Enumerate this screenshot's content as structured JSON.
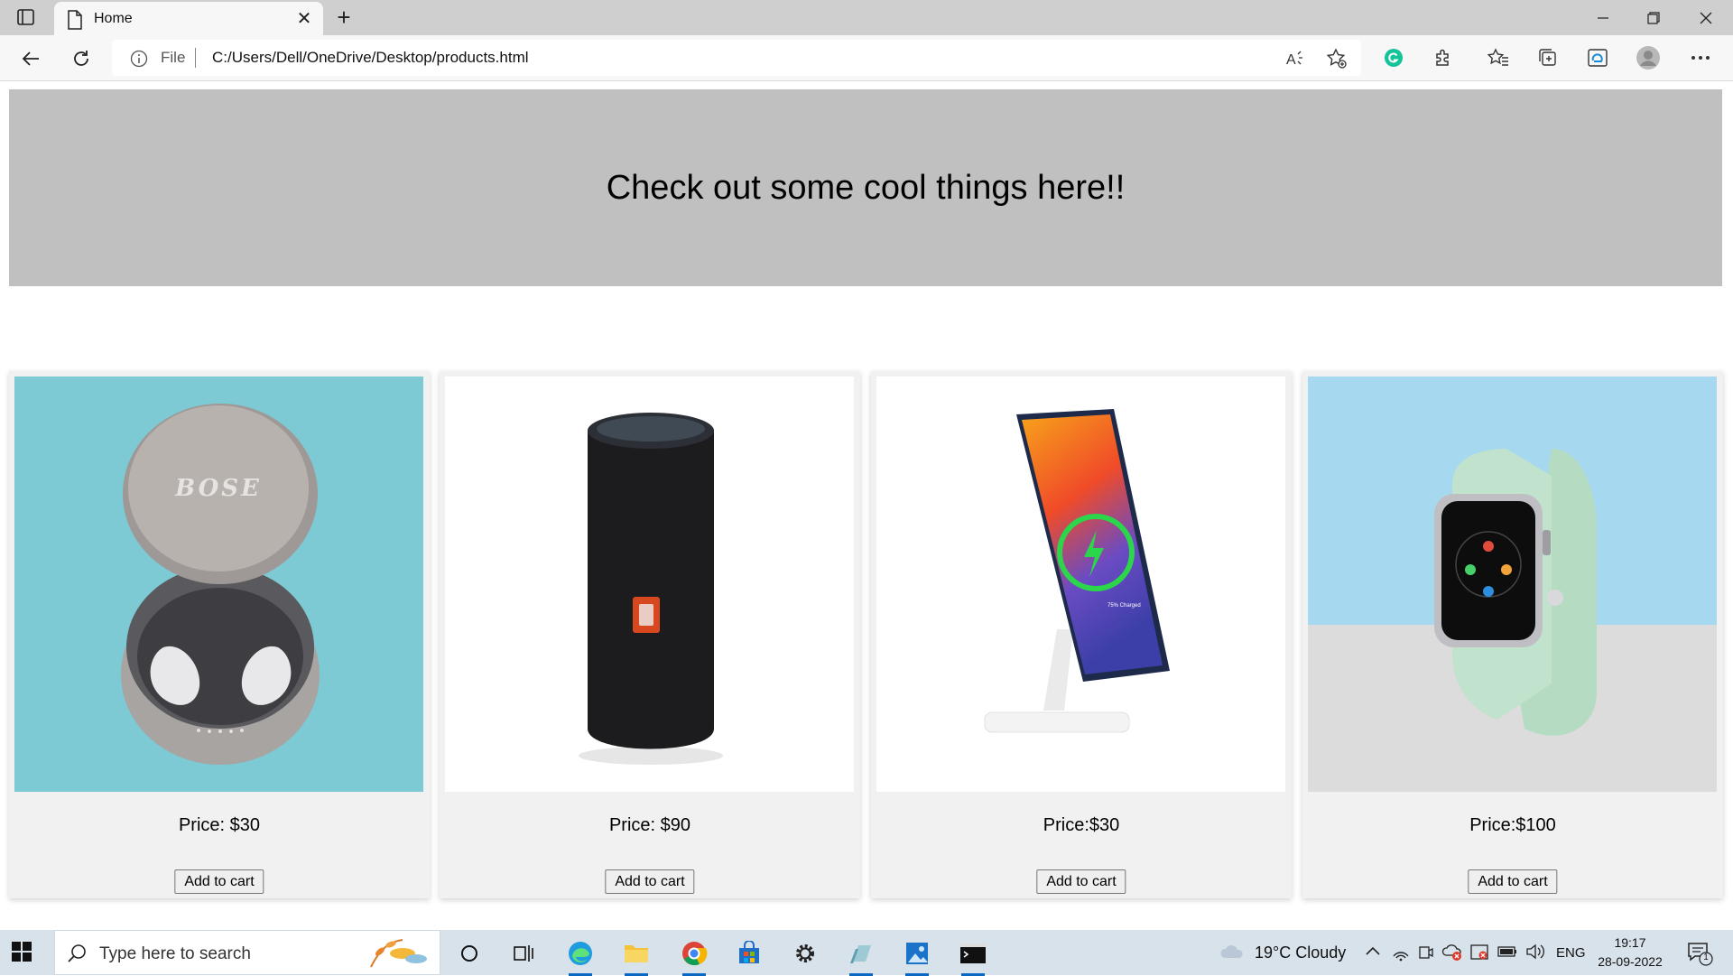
{
  "browser": {
    "tab_title": "Home",
    "address_prefix": "File",
    "url": "C:/Users/Dell/OneDrive/Desktop/products.html",
    "accent": "#0a68c2"
  },
  "page": {
    "banner_text": "Check out some cool things here!!",
    "products": [
      {
        "name": "bose-sleepbuds",
        "price_label": "Price: $30",
        "button_label": "Add to cart"
      },
      {
        "name": "jbl-speaker",
        "price_label": "Price: $90",
        "button_label": "Add to cart"
      },
      {
        "name": "wireless-charger",
        "price_label": "Price:$30",
        "button_label": "Add to cart"
      },
      {
        "name": "smart-watch",
        "price_label": "Price:$100",
        "button_label": "Add to cart"
      }
    ]
  },
  "taskbar": {
    "search_placeholder": "Type here to search",
    "weather": "19°C  Cloudy",
    "language": "ENG",
    "time": "19:17",
    "date": "28-09-2022",
    "notification_count": "1"
  }
}
